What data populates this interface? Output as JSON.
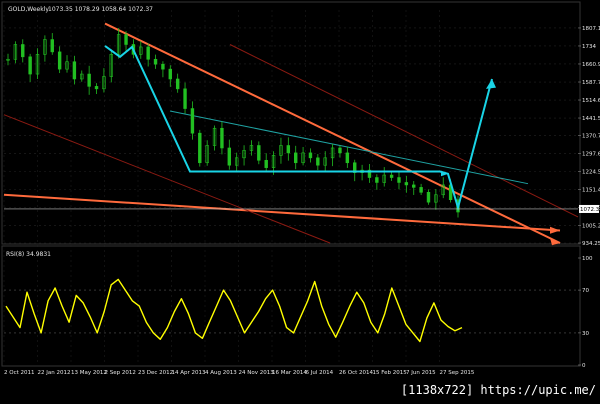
{
  "header": {
    "symbol_text": "GOLD,Weekly",
    "ohlc_text": "1073.35 1078.29 1058.64 1072.37",
    "rsi_text": "RSI(8) 34.9831"
  },
  "footer": {
    "watermark": "[1138x722] https://upic.me/"
  },
  "colors": {
    "background": "#000000",
    "grid": "#232323",
    "candles": "#22c022",
    "rsi": "#ffff00",
    "cyan_lines": "#19d4e6",
    "orange_lines": "#ff6a3c",
    "dark_red_lines": "#8b1a12",
    "teal_line": "#1fa3a3",
    "price_label_bg": "#ffffff"
  },
  "chart_data": [
    {
      "type": "candlestick",
      "title": "GOLD,Weekly",
      "timeframe": "Weekly",
      "last_ohlc": {
        "open": 1073.35,
        "high": 1078.29,
        "low": 1058.64,
        "close": 1072.37
      },
      "current_price_label": "1072.37",
      "y_ticks": [
        1807.1,
        1734.0,
        1660.9,
        1587.7,
        1514.6,
        1441.5,
        1370.7,
        1297.6,
        1224.5,
        1151.4,
        1078.3,
        1005.2,
        934.25
      ],
      "x_tick_labels": [
        "2 Oct 2011",
        "22 Jan 2012",
        "13 May 2012",
        "2 Sep 2012",
        "23 Dec 2012",
        "14 Apr 2013",
        "4 Aug 2013",
        "24 Nov 2013",
        "16 Mar 2014",
        "6 Jul 2014",
        "26 Oct 2014",
        "15 Feb 2015",
        "7 Jun 2015",
        "27 Sep 2015"
      ],
      "ylim": [
        934.25,
        1880
      ],
      "price_path_estimate": [
        1680,
        1740,
        1690,
        1620,
        1700,
        1760,
        1710,
        1640,
        1670,
        1600,
        1620,
        1570,
        1560,
        1610,
        1700,
        1780,
        1740,
        1700,
        1730,
        1680,
        1660,
        1640,
        1600,
        1560,
        1480,
        1380,
        1260,
        1330,
        1400,
        1320,
        1250,
        1280,
        1310,
        1330,
        1270,
        1240,
        1290,
        1330,
        1300,
        1260,
        1300,
        1280,
        1250,
        1280,
        1320,
        1300,
        1260,
        1220,
        1230,
        1200,
        1180,
        1210,
        1200,
        1180,
        1170,
        1160,
        1140,
        1100,
        1130,
        1170,
        1110,
        1060
      ],
      "annotations": {
        "cyan_zigzag_prices": [
          1734.0,
          1690.0,
          1730.0,
          1224.5,
          1224.5,
          1215.0,
          1078.3,
          1600.0
        ],
        "cyan_horizontal_level": 1224.5,
        "current_price_line": 1072.37
      }
    },
    {
      "type": "line",
      "title": "RSI(8) 34.9831",
      "indicator": "RSI",
      "period": 8,
      "last_value": 34.9831,
      "ylim": [
        0,
        100
      ],
      "y_ticks": [
        100,
        70,
        30,
        0
      ],
      "levels": [
        70,
        30
      ],
      "values": [
        55,
        45,
        35,
        68,
        48,
        30,
        60,
        72,
        55,
        40,
        65,
        58,
        45,
        30,
        50,
        75,
        80,
        70,
        60,
        55,
        40,
        30,
        24,
        35,
        50,
        62,
        48,
        30,
        25,
        40,
        55,
        70,
        60,
        45,
        30,
        40,
        50,
        62,
        70,
        55,
        35,
        30,
        45,
        60,
        78,
        55,
        38,
        26,
        40,
        55,
        68,
        58,
        40,
        30,
        48,
        72,
        55,
        38,
        30,
        22,
        44,
        58,
        42,
        36,
        32,
        35
      ]
    }
  ]
}
